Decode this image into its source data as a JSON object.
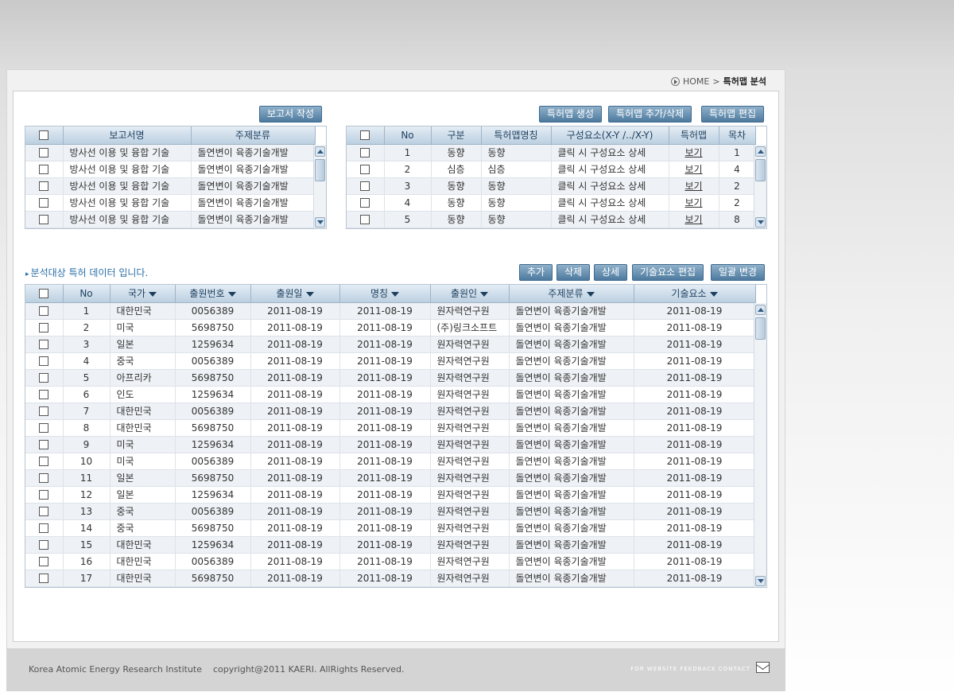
{
  "breadcrumb": {
    "home": "HOME",
    "separator": ">",
    "current": "특허맵 분석"
  },
  "reports": {
    "write_button": "보고서 작성",
    "columns": [
      "보고서명",
      "주제분류"
    ],
    "rows": [
      [
        "방사선 이용 및 융합 기술",
        "돌연변이 육종기술개발"
      ],
      [
        "방사선 이용 및 융합 기술",
        "돌연변이 육종기술개발"
      ],
      [
        "방사선 이용 및 융합 기술",
        "돌연변이 육종기술개발"
      ],
      [
        "방사선 이용 및 융합 기술",
        "돌연변이 육종기술개발"
      ],
      [
        "방사선 이용 및 융합 기술",
        "돌연변이 육종기술개발"
      ]
    ]
  },
  "patent_maps": {
    "buttons": [
      "특허맵 생성",
      "특허맵 추가/삭제",
      "특허맵 편집"
    ],
    "columns": [
      "No",
      "구분",
      "특허맵명칭",
      "구성요소(X-Y /../X-Y)",
      "특허맵",
      "목차"
    ],
    "rows": [
      [
        "1",
        "동향",
        "동향",
        "클릭 시 구성요소 상세",
        "보기",
        "1"
      ],
      [
        "2",
        "심층",
        "심층",
        "클릭 시 구성요소 상세",
        "보기",
        "4"
      ],
      [
        "3",
        "동향",
        "동향",
        "클릭 시 구성요소 상세",
        "보기",
        "2"
      ],
      [
        "4",
        "동향",
        "동향",
        "클릭 시 구성요소 상세",
        "보기",
        "2"
      ],
      [
        "5",
        "동향",
        "동향",
        "클릭 시 구성요소 상세",
        "보기",
        "8"
      ]
    ]
  },
  "patents": {
    "label": "분석대상 특허 데이터 입니다.",
    "buttons": [
      "추가",
      "삭제",
      "상세",
      "기술요소 편집",
      "일괄 변경"
    ],
    "columns": [
      "No",
      "국가",
      "출원번호",
      "출원일",
      "명칭",
      "출원인",
      "주제분류",
      "기술요소"
    ],
    "rows": [
      [
        "1",
        "대한민국",
        "0056389",
        "2011-08-19",
        "2011-08-19",
        "원자력연구원",
        "돌연변이 육종기술개발",
        "2011-08-19"
      ],
      [
        "2",
        "미국",
        "5698750",
        "2011-08-19",
        "2011-08-19",
        "(주)링크소프트",
        "돌연변이 육종기술개발",
        "2011-08-19"
      ],
      [
        "3",
        "일본",
        "1259634",
        "2011-08-19",
        "2011-08-19",
        "원자력연구원",
        "돌연변이 육종기술개발",
        "2011-08-19"
      ],
      [
        "4",
        "중국",
        "0056389",
        "2011-08-19",
        "2011-08-19",
        "원자력연구원",
        "돌연변이 육종기술개발",
        "2011-08-19"
      ],
      [
        "5",
        "아프리카",
        "5698750",
        "2011-08-19",
        "2011-08-19",
        "원자력연구원",
        "돌연변이 육종기술개발",
        "2011-08-19"
      ],
      [
        "6",
        "인도",
        "1259634",
        "2011-08-19",
        "2011-08-19",
        "원자력연구원",
        "돌연변이 육종기술개발",
        "2011-08-19"
      ],
      [
        "7",
        "대한민국",
        "0056389",
        "2011-08-19",
        "2011-08-19",
        "원자력연구원",
        "돌연변이 육종기술개발",
        "2011-08-19"
      ],
      [
        "8",
        "대한민국",
        "5698750",
        "2011-08-19",
        "2011-08-19",
        "원자력연구원",
        "돌연변이 육종기술개발",
        "2011-08-19"
      ],
      [
        "9",
        "미국",
        "1259634",
        "2011-08-19",
        "2011-08-19",
        "원자력연구원",
        "돌연변이 육종기술개발",
        "2011-08-19"
      ],
      [
        "10",
        "미국",
        "0056389",
        "2011-08-19",
        "2011-08-19",
        "원자력연구원",
        "돌연변이 육종기술개발",
        "2011-08-19"
      ],
      [
        "11",
        "일본",
        "5698750",
        "2011-08-19",
        "2011-08-19",
        "원자력연구원",
        "돌연변이 육종기술개발",
        "2011-08-19"
      ],
      [
        "12",
        "일본",
        "1259634",
        "2011-08-19",
        "2011-08-19",
        "원자력연구원",
        "돌연변이 육종기술개발",
        "2011-08-19"
      ],
      [
        "13",
        "중국",
        "0056389",
        "2011-08-19",
        "2011-08-19",
        "원자력연구원",
        "돌연변이 육종기술개발",
        "2011-08-19"
      ],
      [
        "14",
        "중국",
        "5698750",
        "2011-08-19",
        "2011-08-19",
        "원자력연구원",
        "돌연변이 육종기술개발",
        "2011-08-19"
      ],
      [
        "15",
        "대한민국",
        "1259634",
        "2011-08-19",
        "2011-08-19",
        "원자력연구원",
        "돌연변이 육종기술개발",
        "2011-08-19"
      ],
      [
        "16",
        "대한민국",
        "0056389",
        "2011-08-19",
        "2011-08-19",
        "원자력연구원",
        "돌연변이 육종기술개발",
        "2011-08-19"
      ],
      [
        "17",
        "대한민국",
        "5698750",
        "2011-08-19",
        "2011-08-19",
        "원자력연구원",
        "돌연변이 육종기술개발",
        "2011-08-19"
      ]
    ]
  },
  "footer": {
    "copyright": "Korea Atomic Energy Research Institute    copyright@2011 KAERI. AllRights Reserved.",
    "feedback": "FOR WEBSITE FEEDBACK CONTACT"
  },
  "colors": {
    "link": "#e25a00",
    "button": "#4d7a9f",
    "header": "#bcd0e1",
    "label": "#2b6fa8"
  }
}
